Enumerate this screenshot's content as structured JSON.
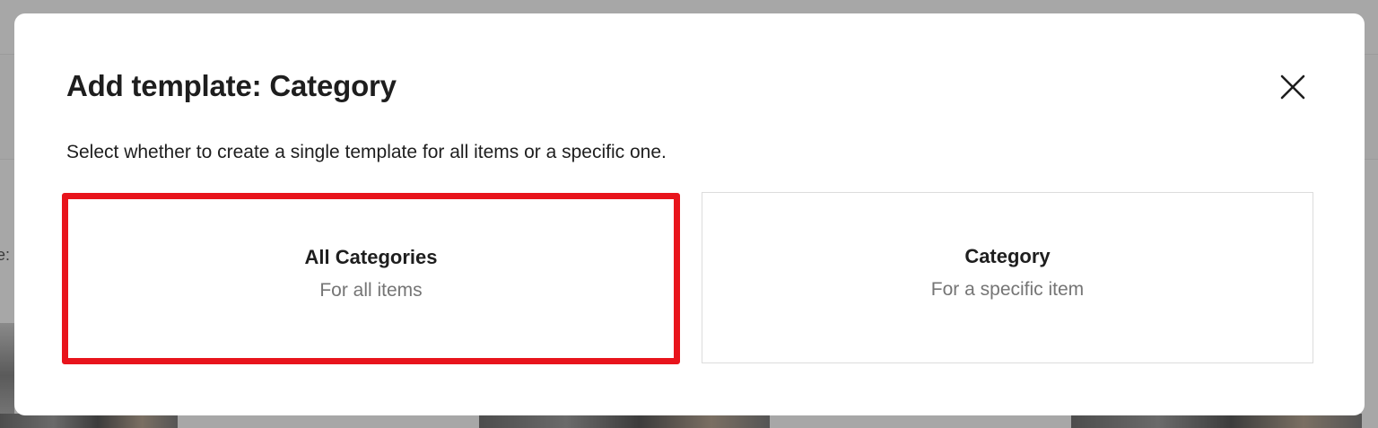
{
  "background": {
    "left_fragment": "e:"
  },
  "modal": {
    "title": "Add template: Category",
    "description": "Select whether to create a single template for all items or a specific one.",
    "close_icon": "close-icon",
    "options": [
      {
        "title": "All Categories",
        "subtitle": "For all items",
        "highlighted": true,
        "highlight_color": "#e8141c"
      },
      {
        "title": "Category",
        "subtitle": "For a specific item",
        "highlighted": false
      }
    ]
  }
}
